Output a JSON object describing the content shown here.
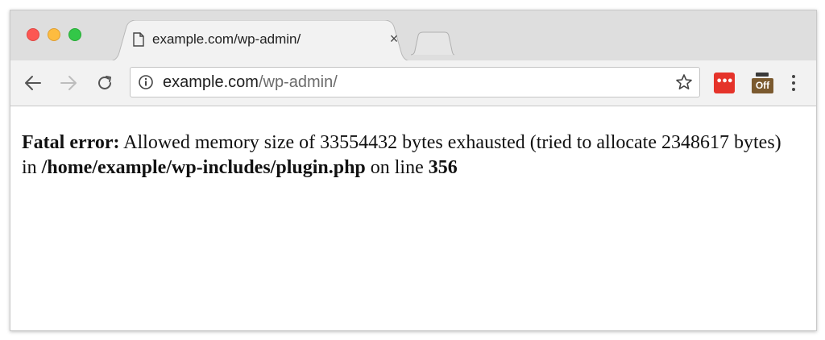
{
  "window": {
    "traffic_lights": [
      {
        "name": "close",
        "color": "#fc5753"
      },
      {
        "name": "minimize",
        "color": "#fdbc40"
      },
      {
        "name": "maximize",
        "color": "#33c748"
      }
    ]
  },
  "tab": {
    "title": "example.com/wp-admin/",
    "icon": "document-icon",
    "close_label": "×"
  },
  "toolbar": {
    "back_icon": "back-arrow-icon",
    "forward_icon": "forward-arrow-icon",
    "reload_icon": "reload-icon",
    "url_domain": "example.com",
    "url_path": "/wp-admin/",
    "bookmark_icon": "star-icon",
    "extensions": [
      {
        "name": "lastpass-extension",
        "label": "•••",
        "color": "#e5332a"
      },
      {
        "name": "off-extension",
        "label": "Off",
        "color": "#7b5a2f"
      }
    ],
    "menu_icon": "kebab-menu-icon"
  },
  "page": {
    "error_label": "Fatal error:",
    "error_text_1": " Allowed memory size of 33554432 bytes exhausted (tried to allocate 2348617 bytes) in ",
    "error_path": "/home/example/wp-includes/plugin.php",
    "error_text_2": " on line ",
    "error_line": "356"
  }
}
